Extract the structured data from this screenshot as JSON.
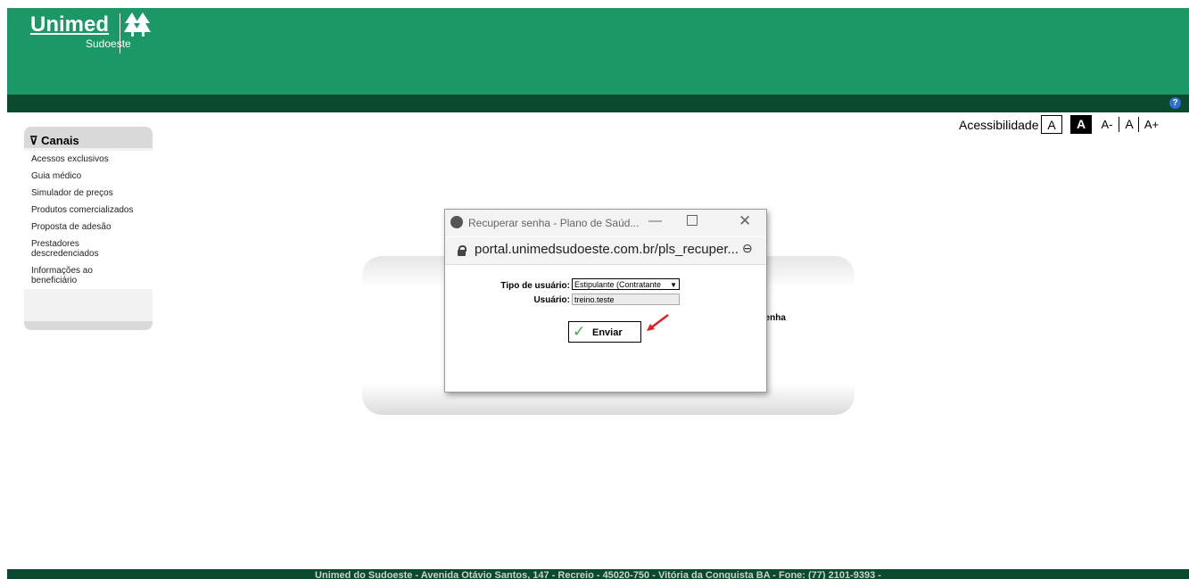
{
  "brand": {
    "name": "Unimed",
    "region": "Sudoeste",
    "primary_color": "#1c9766",
    "dark_color": "#0b4a2c"
  },
  "accessibility": {
    "label": "Acessibilidade",
    "normal": "A",
    "contrast": "A",
    "smaller": "A-",
    "default": "A",
    "larger": "A+"
  },
  "help": {
    "icon": "help-icon",
    "glyph": "?"
  },
  "sidebar": {
    "title": "Canais",
    "items": [
      "Acessos exclusivos",
      "Guia médico",
      "Simulador de preços",
      "Produtos comercializados",
      "Proposta de adesão",
      "Prestadores descredenciados",
      "Informações ao beneficiário"
    ]
  },
  "background_panel": {
    "partial_text": "senha"
  },
  "popup": {
    "title": "Recuperar senha - Plano de Saúd...",
    "url": "portal.unimedsudoeste.com.br/pls_recuper...",
    "controls": {
      "minimize": "—",
      "close": "✕"
    },
    "form": {
      "tipo_label": "Tipo de usuário:",
      "tipo_value": "Estipulante (Contratante",
      "usuario_label": "Usuário:",
      "usuario_value": "treino.teste",
      "submit_label": "Enviar"
    }
  },
  "footer": {
    "text": "Unimed do Sudoeste - Avenida Otávio Santos, 147 - Recreio - 45020-750 - Vitória da Conquista BA - Fone: (77) 2101-9393 -"
  }
}
